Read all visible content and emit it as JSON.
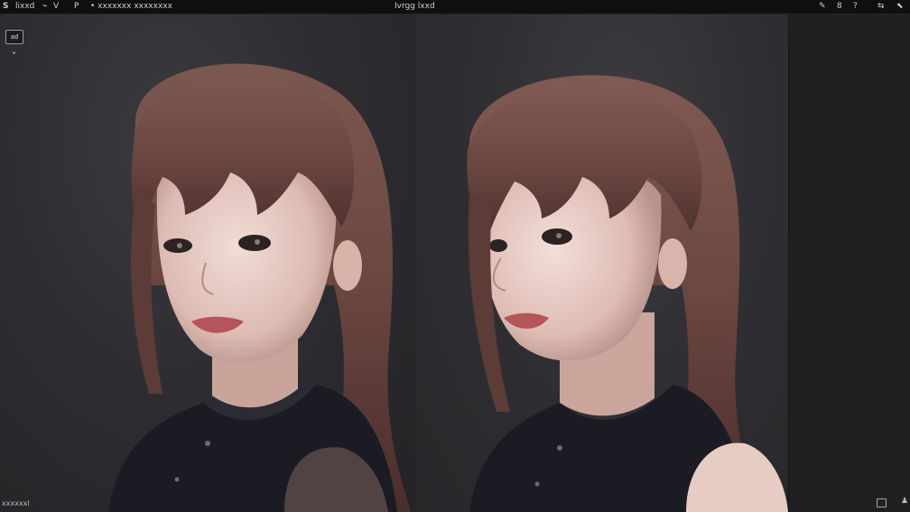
{
  "topbar": {
    "app_glyph": "S",
    "menu_1": "lixxd",
    "menu_2": "V",
    "menu_3": "P",
    "project_name": "• xxxxxxx xxxxxxxx",
    "title": "Ivrgg lxxd",
    "right_glyph_1": "8",
    "right_glyph_2": "?"
  },
  "toolbar": {
    "tool_label": "ad"
  },
  "status": {
    "left_text": "xxxxxxl"
  },
  "colors": {
    "background": "#2b2b2f",
    "topbar": "#0f0f11",
    "dock": "#202023",
    "hair": "#6a4a44"
  }
}
